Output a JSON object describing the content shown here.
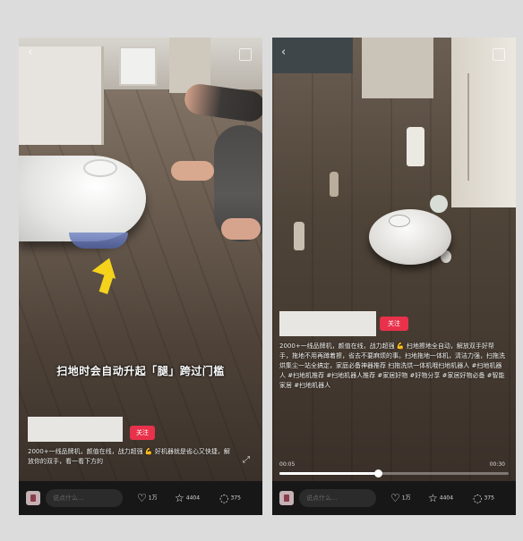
{
  "left": {
    "subtitle": "扫地时会自动升起「腿」跨过门槛",
    "badge": "关注",
    "caption": "2000+一线品牌机，颜值在线，战力超强 💪 好机器就是省心又快捷，解放你的双手，看一看下方的",
    "comment_placeholder": "说点什么...",
    "likes": "1万",
    "stars": "4404",
    "comments": "375"
  },
  "right": {
    "badge": "关注",
    "caption": "2000+一线品牌机，颜值在线，战力超强 💪 扫地擦地全自动，解放双手好帮手，拖地不用再蹲着擦，省去不要麻烦的事。扫地拖地一体机，清洁力强，扫拖洗烘集尘一站全搞定，家庭必备神器推荐 扫拖洗烘一体机哦扫地机器人 #扫地机器人 #扫地机推荐 #扫地机器人推荐 #家居好物 #好物分享 #家居好物必备 #智能家居 #扫地机器人",
    "time_current": "00:05",
    "time_total": "00:30",
    "progress": 0.43,
    "comment_placeholder": "说点什么...",
    "likes": "1万",
    "stars": "4404",
    "comments": "375"
  },
  "icons": {
    "back": "back-chevron-icon",
    "share": "share-icon",
    "expand": "expand-icon",
    "like": "heart-icon",
    "star": "star-icon",
    "comment": "comment-bubble-icon"
  },
  "colors": {
    "badge": "#e8314a",
    "arrow": "#f5d21c",
    "bottom_bar": "#171717"
  }
}
